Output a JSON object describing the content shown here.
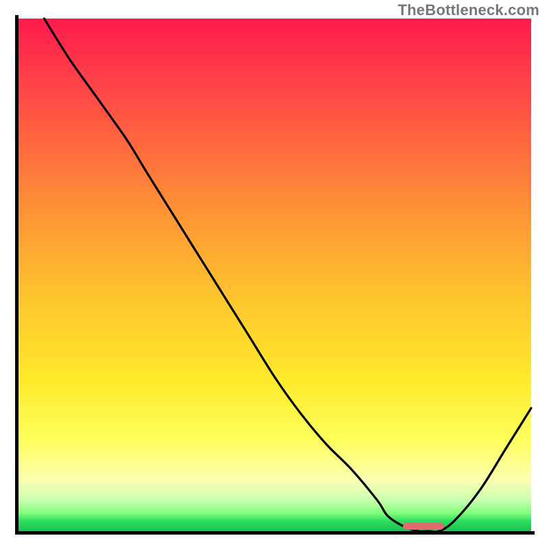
{
  "watermark": "TheBottleneck.com",
  "colors": {
    "gradient_top": "#ff1a4d",
    "gradient_mid": "#ffe92a",
    "gradient_bottom": "#18c24b",
    "axis": "#000000",
    "curve": "#000000",
    "marker": "#e06a6f",
    "watermark": "#777777"
  },
  "chart_data": {
    "type": "line",
    "title": "",
    "xlabel": "",
    "ylabel": "",
    "xlim": [
      0,
      100
    ],
    "ylim": [
      0,
      100
    ],
    "grid": false,
    "legend": false,
    "series": [
      {
        "name": "bottleneck-curve",
        "x": [
          5,
          10,
          15,
          20,
          22,
          25,
          30,
          35,
          40,
          45,
          50,
          55,
          60,
          65,
          70,
          72,
          75,
          78,
          80,
          82,
          85,
          90,
          95,
          100
        ],
        "y": [
          100,
          92,
          85,
          78,
          75,
          70,
          62,
          54,
          46,
          38,
          30,
          23,
          17,
          12,
          6,
          3,
          1,
          0,
          0,
          0,
          2,
          8,
          16,
          24
        ]
      }
    ],
    "annotations": [
      {
        "name": "optimal-marker",
        "shape": "rounded-bar",
        "x_start": 75,
        "x_end": 83,
        "y": 1,
        "color": "#e06a6f"
      }
    ]
  }
}
